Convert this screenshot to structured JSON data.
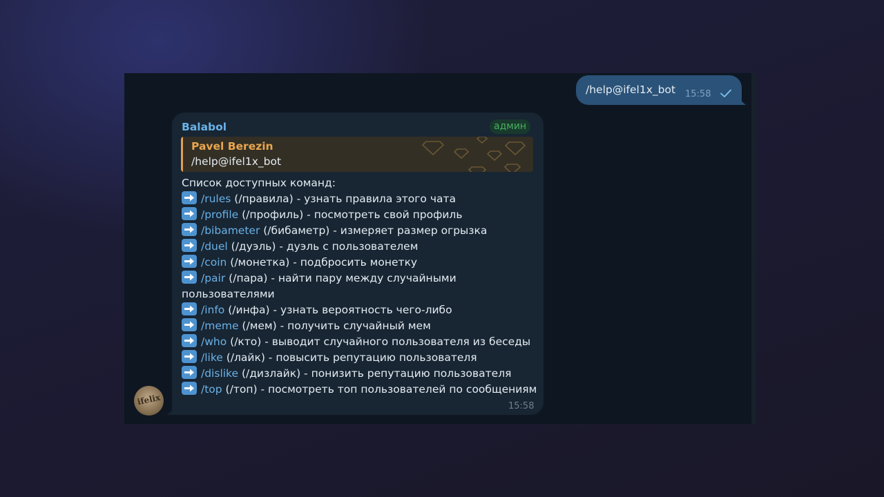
{
  "outgoing": {
    "text": "/help@ifel1x_bot",
    "time": "15:58"
  },
  "avatar": {
    "text": "ifelix"
  },
  "incoming": {
    "sender": "Balabol",
    "badge": "админ",
    "reply": {
      "author": "Pavel Berezin",
      "text": "/help@ifel1x_bot"
    },
    "heading": "Список доступных команд:",
    "commands": [
      {
        "cmd": "/rules",
        "rest": " (/правила) - узнать правила этого чата"
      },
      {
        "cmd": "/profile",
        "rest": " (/профиль) - посмотреть свой профиль"
      },
      {
        "cmd": "/bibameter",
        "rest": " (/бибаметр) - измеряет размер огрызка"
      },
      {
        "cmd": "/duel",
        "rest": " (/дуэль) - дуэль с пользователем"
      },
      {
        "cmd": "/coin",
        "rest": " (/монетка) - подбросить монетку"
      },
      {
        "cmd": "/pair",
        "rest": " (/пара) - найти пару между случайными пользователями"
      },
      {
        "cmd": "/info",
        "rest": " (/инфа) - узнать вероятность чего-либо"
      },
      {
        "cmd": "/meme",
        "rest": " (/мем) - получить случайный мем"
      },
      {
        "cmd": "/who",
        "rest": " (/кто) - выводит случайного пользователя из беседы"
      },
      {
        "cmd": "/like",
        "rest": " (/лайк) - повысить репутацию пользователя"
      },
      {
        "cmd": "/dislike",
        "rest": " (/дизлайк) - понизить репутацию пользователя"
      },
      {
        "cmd": "/top",
        "rest": " (/топ) - посмотреть топ пользователей по сообщениям"
      }
    ],
    "time": "15:58"
  },
  "colors": {
    "chat_bg": "#0e1621",
    "incoming_bubble": "#182533",
    "outgoing_bubble": "#2b5278",
    "link": "#6ab2e7",
    "reply_author": "#e8a64f",
    "admin_badge": "#4cae63"
  },
  "icons": {
    "read_status": "single-check-icon",
    "command_bullet": "right-arrow-emoji-icon",
    "reply_pattern": "diamond-pattern-icon"
  }
}
